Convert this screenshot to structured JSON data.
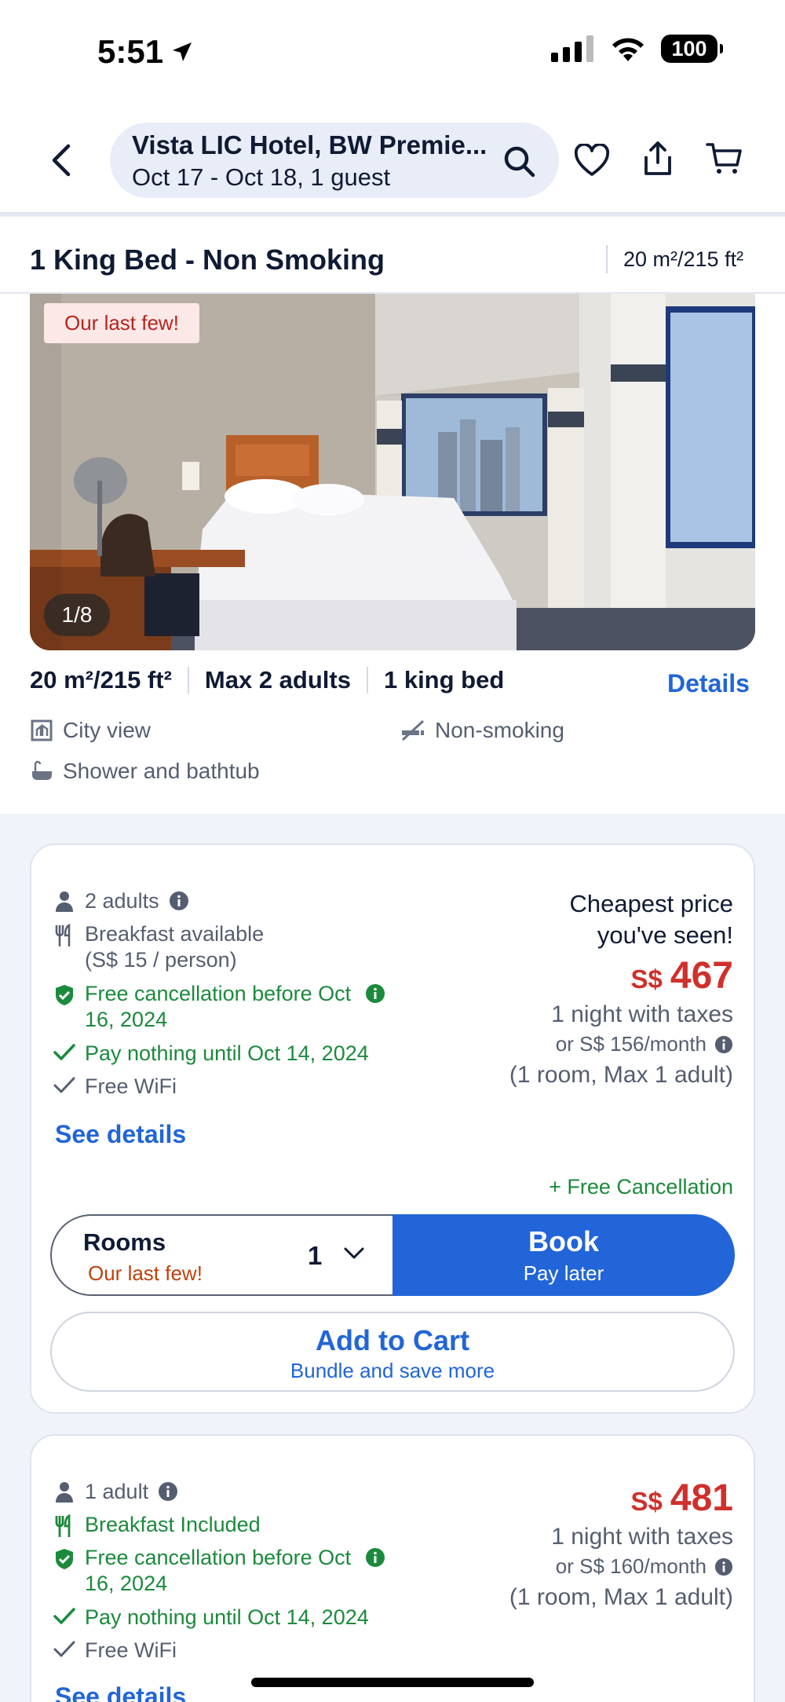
{
  "status_bar": {
    "time": "5:51",
    "battery": "100"
  },
  "header": {
    "hotel_name": "Vista LIC Hotel, BW Premie...",
    "dates_guests": "Oct 17 - Oct 18, 1 guest",
    "icons": [
      "back-icon",
      "search-icon",
      "heart-icon",
      "share-icon",
      "cart-icon"
    ]
  },
  "room": {
    "title": "1 King Bed - Non Smoking",
    "size_top": "20 m²/215 ft²",
    "photo_badge": "Our last few!",
    "photo_counter": "1/8",
    "specs": [
      "20 m²/215 ft²",
      "Max 2 adults",
      "1 king bed"
    ],
    "details_link": "Details",
    "amenities": {
      "city_view": "City view",
      "non_smoking": "Non-smoking",
      "shower": "Shower and bathtub"
    }
  },
  "offers": [
    {
      "guests": "2 adults",
      "breakfast_line1": "Breakfast available",
      "breakfast_line2": "(S$ 15 / person)",
      "cancel_line1": "Free cancellation before Oct",
      "cancel_line2": "16, 2024",
      "pay_later": "Pay nothing until Oct 14, 2024",
      "wifi": "Free WiFi",
      "see_details": "See details",
      "cheapest_line1": "Cheapest price",
      "cheapest_line2": "you've seen!",
      "currency": "S$",
      "price": "467",
      "price_note": "1 night with taxes",
      "monthly": "or S$ 156/month",
      "occupancy": "(1 room, Max 1 adult)",
      "free_cancel_tag": "+ Free Cancellation",
      "rooms_label": "Rooms",
      "rooms_note": "Our last few!",
      "rooms_qty": "1",
      "book_label": "Book",
      "book_sub": "Pay later",
      "cart_label": "Add to Cart",
      "cart_sub": "Bundle and save more"
    },
    {
      "guests": "1 adult",
      "breakfast": "Breakfast Included",
      "cancel_line1": "Free cancellation before Oct",
      "cancel_line2": "16, 2024",
      "pay_later": "Pay nothing until Oct 14, 2024",
      "wifi": "Free WiFi",
      "see_details": "See details",
      "currency": "S$",
      "price": "481",
      "price_note": "1 night with taxes",
      "monthly": "or S$ 160/month",
      "occupancy": "(1 room, Max 1 adult)"
    }
  ],
  "colors": {
    "accent": "#2165d8",
    "price": "#d0302b",
    "positive": "#1c8a3c",
    "warning": "#c2410c"
  }
}
